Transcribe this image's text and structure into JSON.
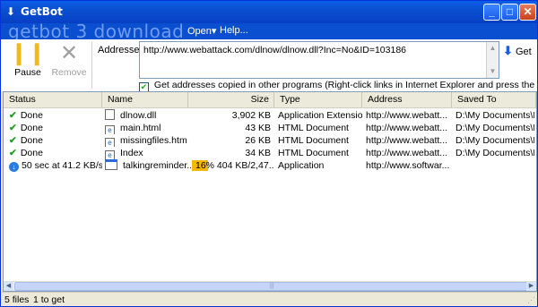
{
  "window": {
    "title": "GetBot",
    "brand": "getbot 3 download",
    "icon": "down-arrow-icon"
  },
  "menu": {
    "open": "Open",
    "help": "Help..."
  },
  "toolbar": {
    "pause_label": "Pause",
    "remove_label": "Remove",
    "addresses_label": "Addresses",
    "address_value": "http://www.webattack.com/dlnow/dlnow.dll?Inc=No&ID=103186",
    "get_label": "Get",
    "clipboard_checked": true,
    "clipboard_label": "Get addresses copied in other programs (Right-click links in Internet Explorer and press the T key)"
  },
  "columns": {
    "status": "Status",
    "name": "Name",
    "size": "Size",
    "type": "Type",
    "address": "Address",
    "saved_to": "Saved To"
  },
  "rows": [
    {
      "status": "Done",
      "name": "dlnow.dll",
      "size": "3,902 KB",
      "type": "Application Extension",
      "address": "http://www.webatt...",
      "saved_to": "D:\\My Documents\\M..."
    },
    {
      "status": "Done",
      "name": "main.html",
      "size": "43 KB",
      "type": "HTML Document",
      "address": "http://www.webatt...",
      "saved_to": "D:\\My Documents\\M..."
    },
    {
      "status": "Done",
      "name": "missingfiles.html",
      "size": "26 KB",
      "type": "HTML Document",
      "address": "http://www.webatt...",
      "saved_to": "D:\\My Documents\\M..."
    },
    {
      "status": "Done",
      "name": "Index",
      "size": "34 KB",
      "type": "HTML Document",
      "address": "http://www.webatt...",
      "saved_to": "D:\\My Documents\\M..."
    },
    {
      "status": "50 sec at 41.2 KB/s...",
      "name": "talkingreminder...",
      "size": "16% 404 KB/2,47...",
      "progress_percent": 16,
      "type": "Application",
      "address": "http://www.softwar...",
      "saved_to": ""
    }
  ],
  "statusbar": {
    "files": "5 files",
    "to_get": "1 to get"
  },
  "colors": {
    "titlebar": "#0a4fd0",
    "progress": "#f5b700",
    "done_check": "#21a121"
  }
}
